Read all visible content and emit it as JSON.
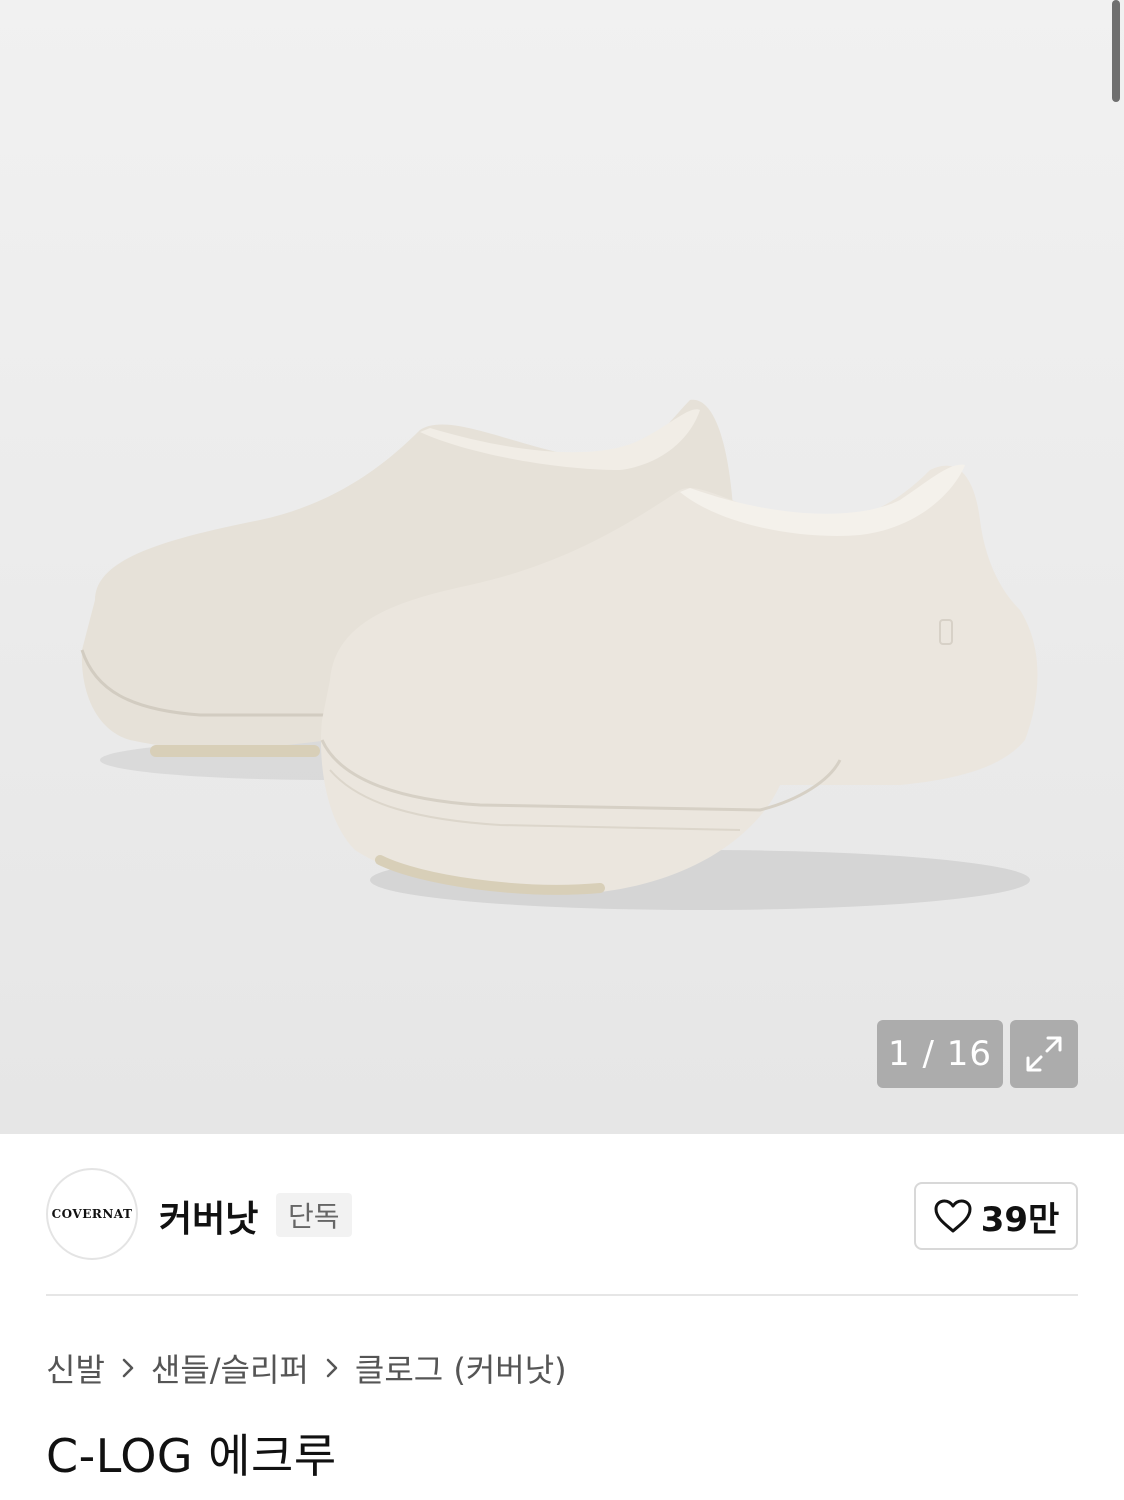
{
  "gallery": {
    "counter": "1 / 16"
  },
  "brand": {
    "logo_text": "COVERNAT",
    "name": "커버낫",
    "badge": "단독"
  },
  "like": {
    "count": "39만"
  },
  "breadcrumb": {
    "items": [
      "신발",
      "샌들/슬리퍼",
      "클로그 (커버낫)"
    ]
  },
  "product": {
    "title": "C-LOG 에크루"
  }
}
